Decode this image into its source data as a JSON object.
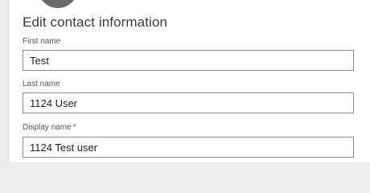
{
  "dialog": {
    "title": "Edit contact information"
  },
  "fields": {
    "first_name": {
      "label": "First name",
      "value": "Test"
    },
    "last_name": {
      "label": "Last name",
      "value": "1124 User"
    },
    "display_name": {
      "label": "Display name",
      "required_marker": "*",
      "value": "1124 Test user"
    }
  },
  "colors": {
    "required": "#c0392b",
    "input_border": "#8a8a8a",
    "title_text": "#3a3a3a"
  }
}
